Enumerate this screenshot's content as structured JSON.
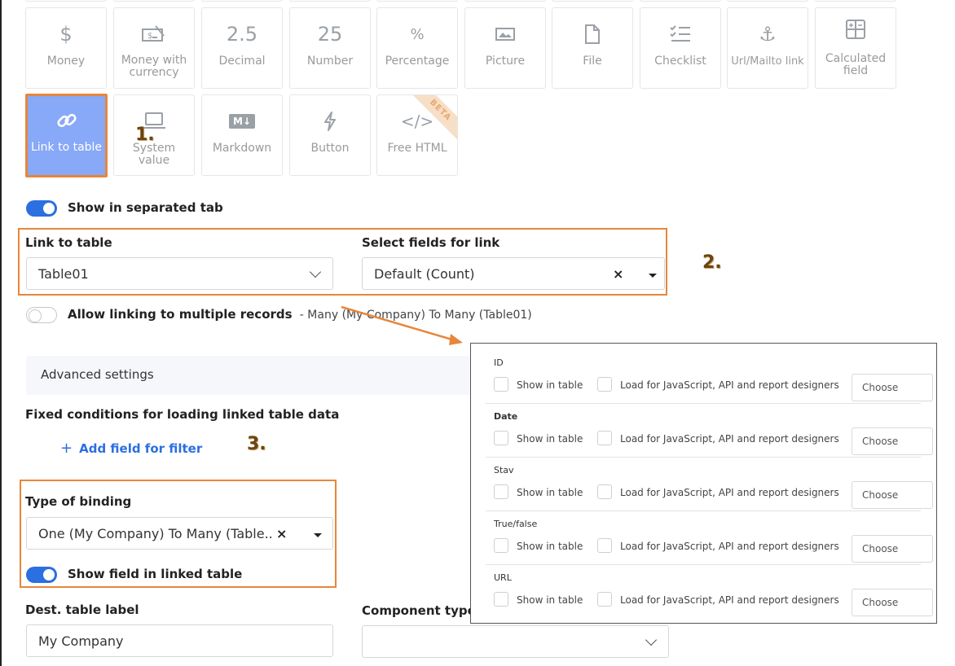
{
  "field_types": {
    "row1": [
      {
        "label": "Money",
        "icon": "dollar-icon",
        "glyph": "$"
      },
      {
        "label": "Money with currency",
        "icon": "money-currency-icon",
        "glyph": ""
      },
      {
        "label": "Decimal",
        "icon": "decimal-icon",
        "glyph": "2.5"
      },
      {
        "label": "Number",
        "icon": "number-icon",
        "glyph": "25"
      },
      {
        "label": "Percentage",
        "icon": "percent-icon",
        "glyph": "%"
      },
      {
        "label": "Picture",
        "icon": "picture-icon",
        "glyph": ""
      },
      {
        "label": "File",
        "icon": "file-icon",
        "glyph": ""
      },
      {
        "label": "Checklist",
        "icon": "checklist-icon",
        "glyph": ""
      },
      {
        "label": "Url/Mailto link",
        "icon": "anchor-icon",
        "glyph": "⚓"
      },
      {
        "label": "Calculated field",
        "icon": "calculator-icon",
        "glyph": ""
      }
    ],
    "row2": [
      {
        "label": "Link to table",
        "icon": "link-icon",
        "selected": true
      },
      {
        "label": "System value",
        "icon": "laptop-icon"
      },
      {
        "label": "Markdown",
        "icon": "markdown-icon",
        "glyph": "M↓"
      },
      {
        "label": "Button",
        "icon": "lightning-icon"
      },
      {
        "label": "Free HTML",
        "icon": "code-icon",
        "glyph": "</>",
        "badge": "BETA"
      }
    ]
  },
  "annotations": {
    "one": "1.",
    "two": "2.",
    "three": "3."
  },
  "show_in_separated_tab": {
    "label": "Show in separated tab",
    "on": true
  },
  "link_to_table": {
    "label": "Link to table",
    "value": "Table01"
  },
  "select_fields": {
    "label": "Select fields for link",
    "value": "Default (Count)",
    "clear": "×"
  },
  "allow_multiple": {
    "label": "Allow linking to multiple records",
    "detail": "- Many (My Company) To Many (Table01)",
    "on": false
  },
  "advanced_settings": {
    "label": "Advanced settings"
  },
  "fixed_conditions": {
    "label": "Fixed conditions for loading linked table data"
  },
  "add_filter": {
    "plus": "+",
    "label": "Add field for filter"
  },
  "type_of_binding": {
    "label": "Type of binding",
    "value": "One (My Company) To Many (Table..",
    "clear": "×"
  },
  "show_field_linked": {
    "label": "Show field in linked table",
    "on": true
  },
  "dest_table_label": {
    "label": "Dest. table label",
    "value": "My Company"
  },
  "component_type": {
    "label": "Component type",
    "value": ""
  },
  "fields_panel": {
    "show_label": "Show in table",
    "load_label": "Load for JavaScript, API and report designers",
    "choose_label": "Choose",
    "rows": [
      {
        "name": "ID",
        "bold": false
      },
      {
        "name": "Date",
        "bold": true
      },
      {
        "name": "Stav",
        "bold": false
      },
      {
        "name": "True/false",
        "bold": false
      },
      {
        "name": "URL",
        "bold": false
      }
    ]
  },
  "colors": {
    "accent": "#2b6fe0",
    "annotation_border": "#e8863a",
    "selected_tile": "#88a8f8"
  }
}
